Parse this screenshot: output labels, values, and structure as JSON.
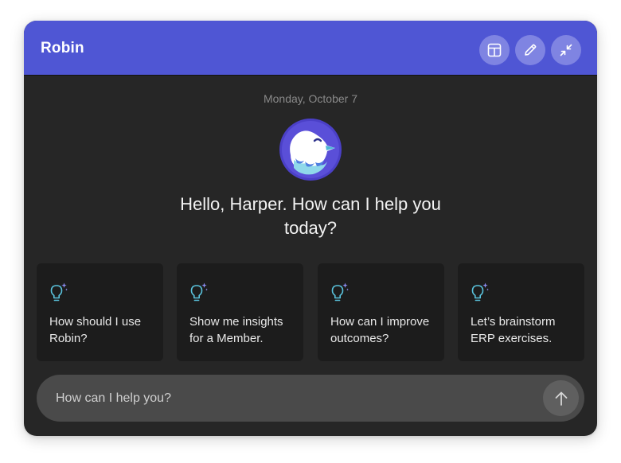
{
  "header": {
    "title": "Robin",
    "accent_color": "#4f56d4",
    "buttons": [
      {
        "icon": "layout-panel-icon"
      },
      {
        "icon": "pencil-icon"
      },
      {
        "icon": "minimize-icon"
      }
    ]
  },
  "conversation": {
    "date": "Monday, October 7",
    "greeting": "Hello, Harper. How can I help you today?"
  },
  "suggestions": [
    {
      "icon": "lightbulb-sparkle-icon",
      "text": "How should I use Robin?"
    },
    {
      "icon": "lightbulb-sparkle-icon",
      "text": "Show me insights for a Member."
    },
    {
      "icon": "lightbulb-sparkle-icon",
      "text": "How can I improve outcomes?"
    },
    {
      "icon": "lightbulb-sparkle-icon",
      "text": "Let’s brainstorm ERP exercises."
    }
  ],
  "composer": {
    "placeholder": "How can I help you?",
    "send_icon": "arrow-up-icon"
  }
}
